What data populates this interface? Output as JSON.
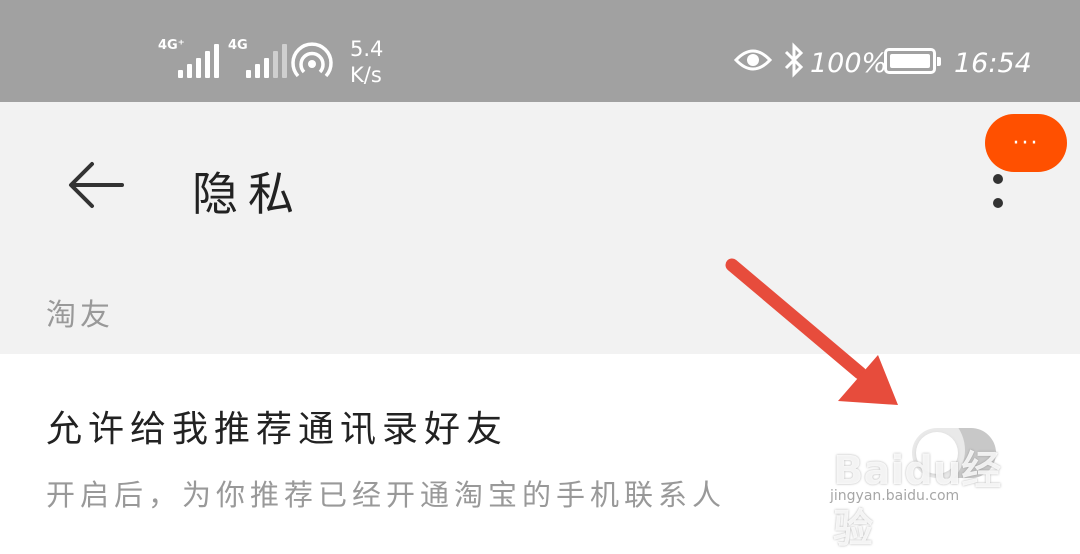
{
  "status_bar": {
    "network_1": "4G⁺",
    "network_2": "4G",
    "speed_value": "5.4",
    "speed_unit": "K/s",
    "battery_pct": "100%",
    "time": "16:54"
  },
  "header": {
    "title": "隐私",
    "fab_label": "···"
  },
  "section": {
    "label": "淘友"
  },
  "setting": {
    "title": "允许给我推荐通讯录好友",
    "description": "开启后，为你推荐已经开通淘宝的手机联系人",
    "enabled": false
  },
  "watermark": {
    "logo": "Baidu经验",
    "url": "jingyan.baidu.com"
  },
  "colors": {
    "status_bar": "#a1a1a1",
    "header_bg": "#f2f2f2",
    "accent": "#ff5000",
    "arrow": "#e74c3c",
    "muted_text": "#999999"
  },
  "icons": [
    "signal-icon",
    "hotspot-icon",
    "eye-icon",
    "bluetooth-icon",
    "battery-icon",
    "back-arrow-icon",
    "more-vert-icon",
    "annotation-arrow-icon"
  ]
}
